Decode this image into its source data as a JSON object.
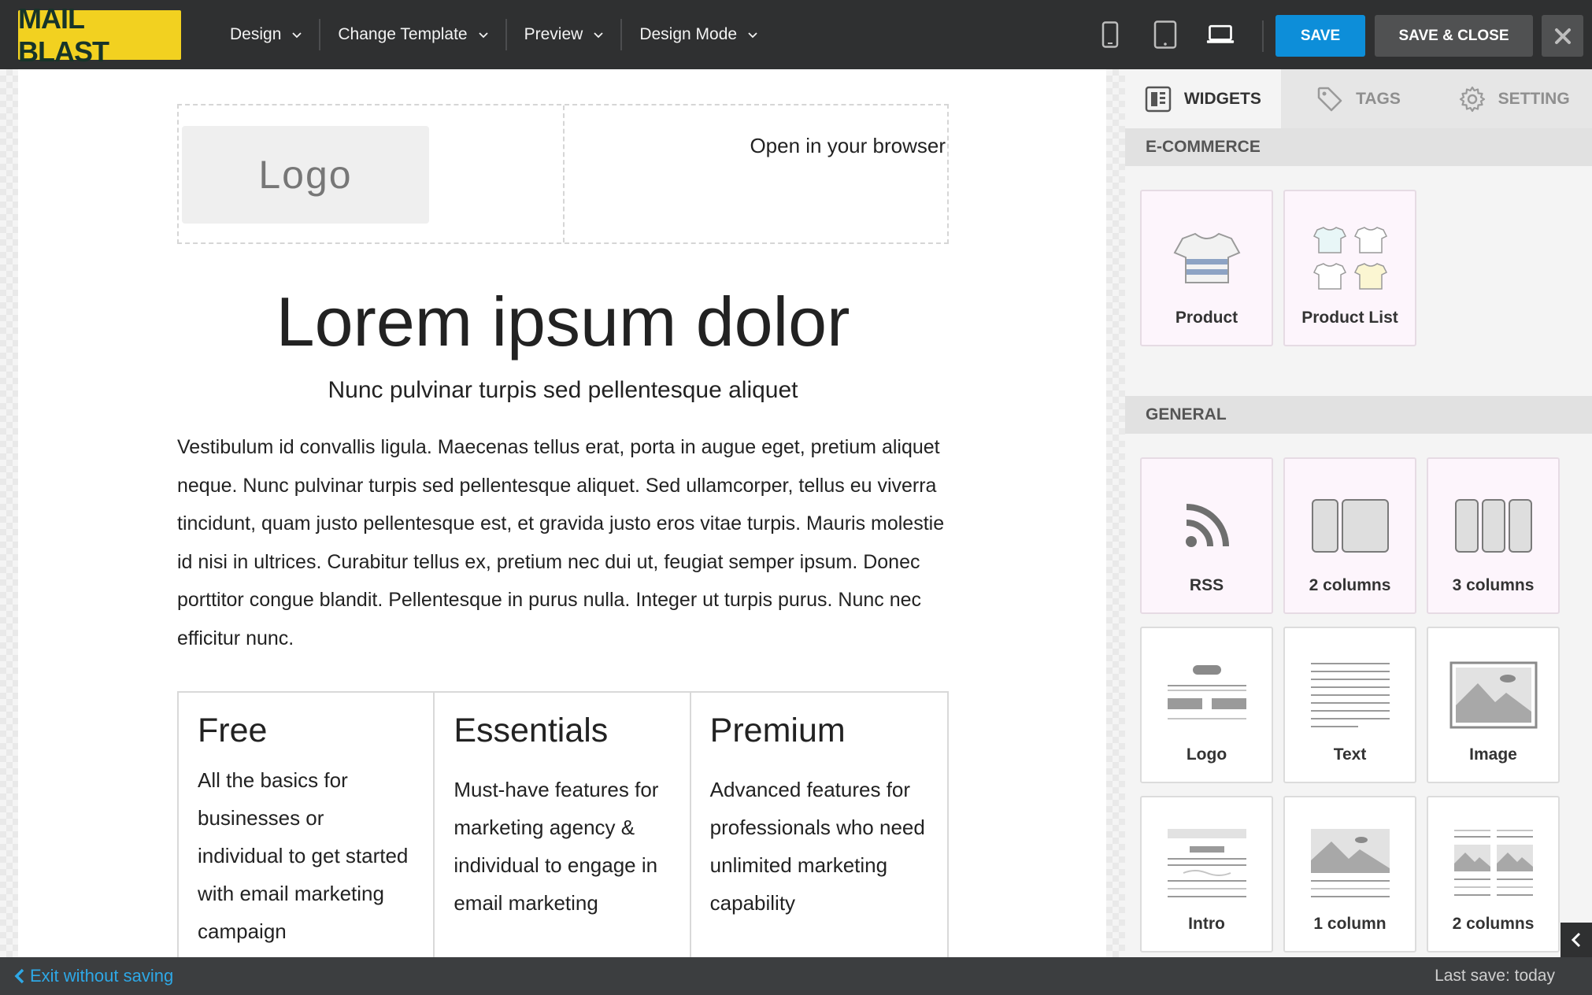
{
  "app": {
    "brand": "MAIL BLAST"
  },
  "toolbar": {
    "menus": [
      {
        "label": "Design"
      },
      {
        "label": "Change Template"
      },
      {
        "label": "Preview"
      },
      {
        "label": "Design Mode"
      }
    ],
    "devices": [
      "mobile-icon",
      "tablet-icon",
      "laptop-icon"
    ],
    "save_label": "SAVE",
    "save_close_label": "SAVE & CLOSE",
    "close_icon": "close-icon"
  },
  "email": {
    "logo_placeholder": "Logo",
    "open_in_browser": "Open in your browser",
    "headline": "Lorem ipsum dolor",
    "subheadline": "Nunc pulvinar turpis sed pellentesque aliquet",
    "body": "Vestibulum id convallis ligula. Maecenas tellus erat, porta in augue eget, pretium aliquet neque. Nunc pulvinar turpis sed pellentesque aliquet. Sed ullamcorper, tellus eu viverra tincidunt, quam justo pellentesque est, et gravida justo eros vitae turpis. Mauris molestie id nisi in ultrices. Curabitur tellus ex, pretium nec dui ut, feugiat semper ipsum. Donec porttitor congue blandit. Pellentesque in purus nulla. Integer ut turpis purus. Nunc nec efficitur nunc.",
    "plans": [
      {
        "title": "Free",
        "description": "All the basics for businesses or individual to get started with email marketing campaign"
      },
      {
        "title": "Essentials",
        "description": "Must-have features for marketing agency & individual to engage in email marketing"
      },
      {
        "title": "Premium",
        "description": "Advanced features for professionals who need unlimited marketing capability"
      }
    ]
  },
  "panel": {
    "tabs": [
      {
        "label": "WIDGETS",
        "icon": "widgets-icon",
        "active": true
      },
      {
        "label": "TAGS",
        "icon": "tag-icon",
        "active": false
      },
      {
        "label": "SETTING",
        "icon": "gear-icon",
        "active": false
      }
    ],
    "sections": [
      {
        "title": "E-COMMERCE",
        "widgets": [
          {
            "label": "Product",
            "icon": "tshirt-icon"
          },
          {
            "label": "Product List",
            "icon": "tshirt-grid-icon"
          }
        ]
      },
      {
        "title": "GENERAL",
        "widgets": [
          {
            "label": "RSS",
            "icon": "rss-icon"
          },
          {
            "label": "2 columns",
            "icon": "two-columns-icon"
          },
          {
            "label": "3 columns",
            "icon": "three-columns-icon"
          },
          {
            "label": "Logo",
            "icon": "logo-block-icon"
          },
          {
            "label": "Text",
            "icon": "text-lines-icon"
          },
          {
            "label": "Image",
            "icon": "image-icon"
          },
          {
            "label": "Intro",
            "icon": "intro-block-icon"
          },
          {
            "label": "1 column",
            "icon": "one-column-image-icon"
          },
          {
            "label": "2 columns",
            "icon": "two-column-images-icon"
          }
        ]
      }
    ]
  },
  "footer": {
    "exit_label": "Exit without saving",
    "last_save": "Last save: today"
  },
  "colors": {
    "topbar": "#2f3031",
    "brand_bg": "#f2d120",
    "save_button": "#0d8ed9",
    "link": "#2ea8e6",
    "widget_highlight": "#fdf5fc"
  }
}
